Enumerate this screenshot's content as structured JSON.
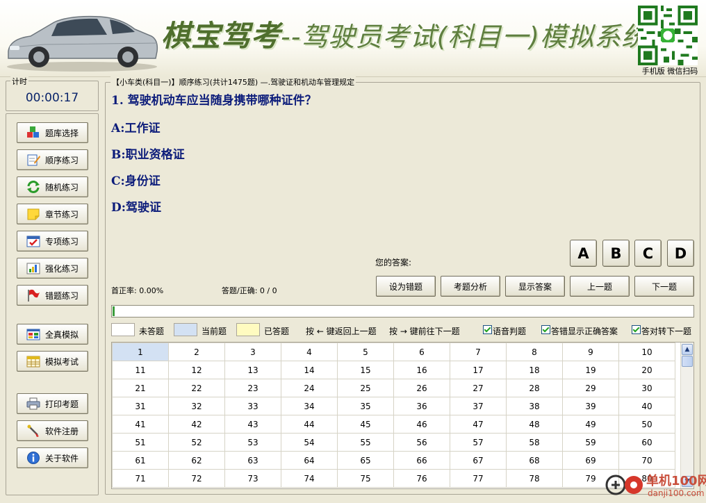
{
  "header": {
    "brand": "棋宝驾考",
    "subtitle": "--驾驶员考试(科目一)模拟系统",
    "qr_caption": "手机版 微信扫码"
  },
  "timer": {
    "label": "计时",
    "value": "00:00:17"
  },
  "nav": {
    "items": [
      {
        "label": "题库选择",
        "icon": "cubes-icon"
      },
      {
        "label": "顺序练习",
        "icon": "notepad-pencil-icon"
      },
      {
        "label": "随机练习",
        "icon": "refresh-arrows-icon"
      },
      {
        "label": "章节练习",
        "icon": "sticky-note-icon"
      },
      {
        "label": "专项练习",
        "icon": "calendar-check-icon"
      },
      {
        "label": "强化练习",
        "icon": "bar-chart-icon"
      },
      {
        "label": "错题练习",
        "icon": "red-flag-icon"
      },
      {
        "label": "全真模拟",
        "icon": "window-grid-icon"
      },
      {
        "label": "模拟考试",
        "icon": "calendar-table-icon"
      },
      {
        "label": "打印考题",
        "icon": "printer-icon"
      },
      {
        "label": "软件注册",
        "icon": "key-wand-icon"
      },
      {
        "label": "关于软件",
        "icon": "info-icon"
      }
    ]
  },
  "breadcrumb": "【小车类(科目一)】顺序练习(共计1475题) —.驾驶证和机动车管理规定",
  "question": {
    "text": "1. 驾驶机动车应当随身携带哪种证件？",
    "options": [
      "A:工作证",
      "B:职业资格证",
      "C:身份证",
      "D:驾驶证"
    ]
  },
  "answer": {
    "label": "您的答案:",
    "buttons": [
      "A",
      "B",
      "C",
      "D"
    ]
  },
  "stats": {
    "rate": "首正率: 0.00%",
    "ratio": "答题/正确: 0 / 0"
  },
  "actions": [
    "设为错题",
    "考题分析",
    "显示答案",
    "上一题",
    "下一题"
  ],
  "progress": 0.003,
  "legend": {
    "unanswered": "未答题",
    "current": "当前题",
    "answered": "已答题",
    "hint_prev": "按 ← 键返回上一题",
    "hint_next": "按 → 键前往下一题",
    "checks": [
      "语音判题",
      "答错显示正确答案",
      "答对转下一题"
    ],
    "colors": {
      "unanswered": "#ffffff",
      "current": "#d3e1f3",
      "answered": "#fffbc0"
    }
  },
  "grid": {
    "current": 1,
    "rows": [
      [
        "1",
        "2",
        "3",
        "4",
        "5",
        "6",
        "7",
        "8",
        "9",
        "10"
      ],
      [
        "11",
        "12",
        "13",
        "14",
        "15",
        "16",
        "17",
        "18",
        "19",
        "20"
      ],
      [
        "21",
        "22",
        "23",
        "24",
        "25",
        "26",
        "27",
        "28",
        "29",
        "30"
      ],
      [
        "31",
        "32",
        "33",
        "34",
        "35",
        "36",
        "37",
        "38",
        "39",
        "40"
      ],
      [
        "41",
        "42",
        "43",
        "44",
        "45",
        "46",
        "47",
        "48",
        "49",
        "50"
      ],
      [
        "51",
        "52",
        "53",
        "54",
        "55",
        "56",
        "57",
        "58",
        "59",
        "60"
      ],
      [
        "61",
        "62",
        "63",
        "64",
        "65",
        "66",
        "67",
        "68",
        "69",
        "70"
      ],
      [
        "71",
        "72",
        "73",
        "74",
        "75",
        "76",
        "77",
        "78",
        "79",
        "80"
      ]
    ]
  },
  "watermark": {
    "top": "单机100网",
    "bottom": "danji100.com"
  }
}
